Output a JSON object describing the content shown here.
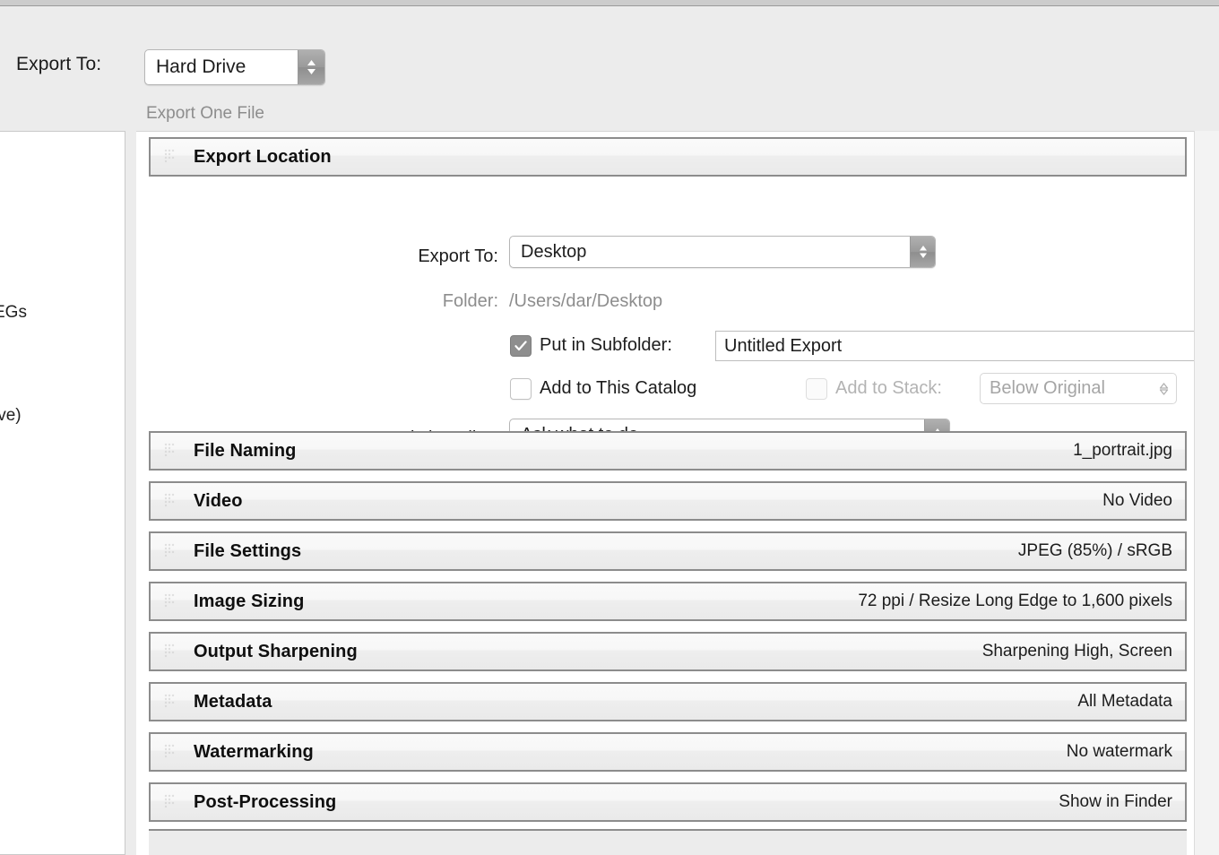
{
  "window": {
    "header": {
      "export_to_label": "Export To:",
      "destination": "Hard Drive",
      "subtitle": "Export One File"
    }
  },
  "preset_panel": {
    "items": [
      {
        "label": "EGs"
      },
      {
        "label": "ive)"
      }
    ]
  },
  "export_location": {
    "title": "Export Location",
    "export_to": {
      "label": "Export To:",
      "value": "Desktop"
    },
    "folder": {
      "label": "Folder:",
      "value": "/Users/dar/Desktop"
    },
    "put_in_subfolder": {
      "label": "Put in Subfolder:",
      "checked": true,
      "value": "Untitled Export"
    },
    "add_to_catalog": {
      "label": "Add to This Catalog",
      "checked": false
    },
    "add_to_stack": {
      "label": "Add to Stack:",
      "checked": false,
      "disabled": true,
      "value": "Below Original"
    },
    "existing_files": {
      "label": "Existing Files:",
      "value": "Ask what to do"
    }
  },
  "sections": [
    {
      "title": "File Naming",
      "summary": "1_portrait.jpg"
    },
    {
      "title": "Video",
      "summary": "No Video"
    },
    {
      "title": "File Settings",
      "summary": "JPEG (85%) / sRGB"
    },
    {
      "title": "Image Sizing",
      "summary": "72 ppi / Resize Long Edge to 1,600 pixels"
    },
    {
      "title": "Output Sharpening",
      "summary": "Sharpening High, Screen"
    },
    {
      "title": "Metadata",
      "summary": "All Metadata"
    },
    {
      "title": "Watermarking",
      "summary": "No watermark"
    },
    {
      "title": "Post-Processing",
      "summary": "Show in Finder"
    }
  ],
  "icons": {
    "stepper": "up-down-chevron-icon",
    "check": "checkmark-icon",
    "grip": "disclosure-grip-icon"
  },
  "colors": {
    "window_bg": "#ececec",
    "panel_bg": "#ffffff",
    "section_border": "#8c8c8c",
    "muted_text": "#8d8d8d",
    "checkbox_on": "#8e8e8e"
  }
}
